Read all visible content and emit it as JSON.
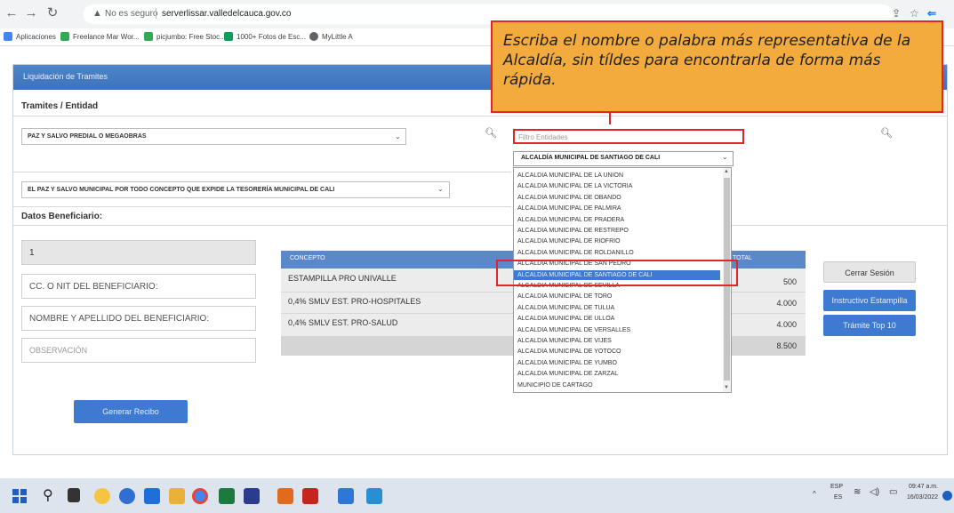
{
  "browser": {
    "insecure_label": "No es seguro",
    "url": "serverlissar.valledelcauca.gov.co",
    "bookmarks": [
      "Aplicaciones",
      "Freelance Mar Wor...",
      "picjumbo: Free Stoc...",
      "1000+ Fotos de Esc...",
      "MyLittle A"
    ]
  },
  "page": {
    "panel_title": "Liquidación de Tramites",
    "tramites_label": "Tramites / Entidad",
    "tramite_select": "PAZ Y SALVO PREDIAL O MEGAOBRAS",
    "concepto_select": "EL PAZ Y SALVO MUNICIPAL POR TODO CONCEPTO QUE EXPIDE LA TESORERÍA MUNICIPAL DE CALI",
    "datos_label": "Datos Beneficiario:",
    "field_1": "1",
    "field_cc": "CC. O NIT DEL BENEFICIARIO:",
    "field_nombre": "NOMBRE Y APELLIDO DEL BENEFICIARIO:",
    "field_obs": "OBSERVACIÓN",
    "generate_button": "Generar Recibo"
  },
  "filter": {
    "placeholder": "Filtro Entidades",
    "selected": "ALCALDÍA MUNICIPAL DE SANTIAGO DE CALI"
  },
  "dropdown_items": [
    "ALCALDIA MUNICIPAL DE LA UNION",
    "ALCALDIA MUNICIPAL DE LA VICTORIA",
    "ALCALDIA MUNICIPAL DE OBANDO",
    "ALCALDIA MUNICIPAL DE PALMIRA",
    "ALCALDIA MUNICIPAL DE PRADERA",
    "ALCALDIA MUNICIPAL DE RESTREPO",
    "ALCALDIA MUNICIPAL DE RIOFRIO",
    "ALCALDIA MUNICIPAL DE ROLDANILLO",
    "ALCALDIA MUNICIPAL DE SAN PEDRO",
    "ALCALDIA MUNICIPAL DE SANTIAGO DE CALI",
    "ALCALDIA MUNICIPAL DE SEVILLA",
    "ALCALDIA MUNICIPAL DE TORO",
    "ALCALDIA MUNICIPAL DE TULUA",
    "ALCALDIA MUNICIPAL DE ULLOA",
    "ALCALDIA MUNICIPAL DE VERSALLES",
    "ALCALDIA MUNICIPAL DE VIJES",
    "ALCALDIA MUNICIPAL DE YOTOCO",
    "ALCALDIA MUNICIPAL DE YUMBO",
    "ALCALDIA MUNICIPAL DE ZARZAL",
    "MUNICIPIO DE CARTAGO"
  ],
  "table": {
    "col_concepto": "CONCEPTO",
    "col_total": "TOTAL",
    "rows": [
      {
        "concepto": "ESTAMPILLA PRO UNIVALLE",
        "total": "500"
      },
      {
        "concepto": "0,4% SMLV EST. PRO-HOSPITALES",
        "total": "4.000"
      },
      {
        "concepto": "0,4% SMLV EST. PRO-SALUD",
        "total": "4.000"
      }
    ],
    "sum": "8.500"
  },
  "side_buttons": {
    "cerrar": "Cerrar Sesión",
    "instructivo": "Instructivo Estampilla",
    "tramite": "Trámite Top 10"
  },
  "callout": "Escriba el nombre o palabra más representativa de la Alcaldía, sin tíldes para encontrarla de forma más rápida.",
  "taskbar": {
    "lang": "ESP",
    "lang2": "ES",
    "time": "09:47 a.m.",
    "date": "16/03/2022"
  },
  "colors": {
    "accent": "#3e7ad1",
    "callout_bg": "#f2ab3c",
    "highlight": "#e0262b"
  }
}
